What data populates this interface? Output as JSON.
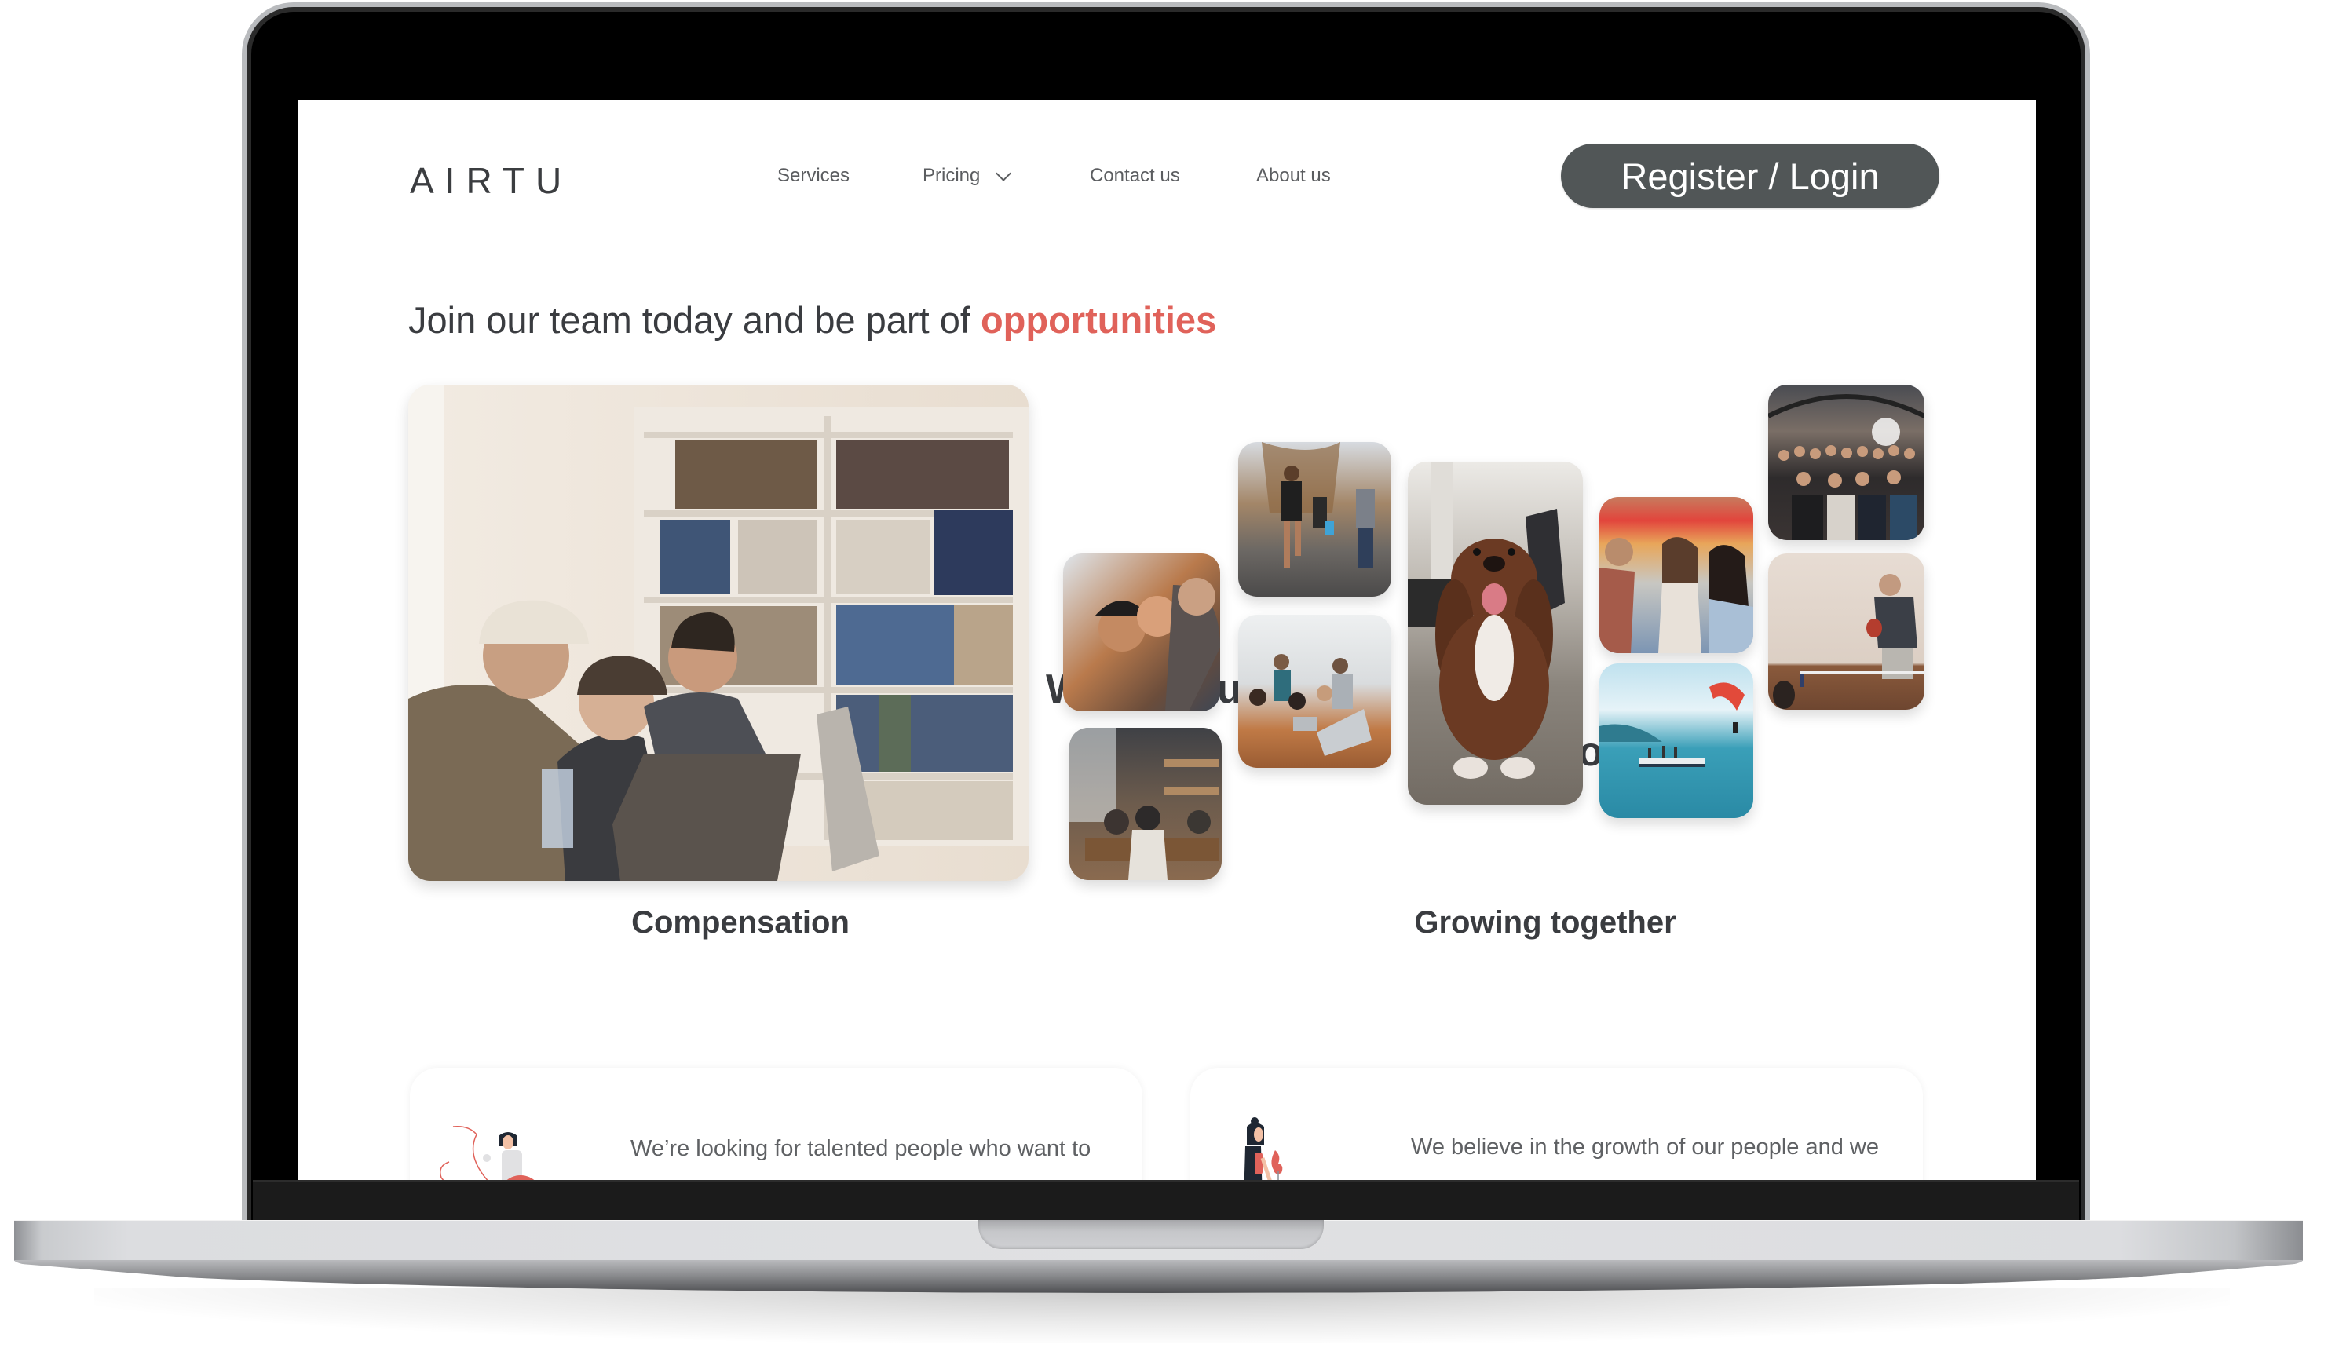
{
  "brand": {
    "logo_text": "AIRTU",
    "accent_color": "#e0625a",
    "button_color": "#515657",
    "text_color": "#3a3c40"
  },
  "nav": {
    "items": [
      {
        "label": "Services"
      },
      {
        "label": "Pricing",
        "has_dropdown": true,
        "icon": "chevron-down-icon"
      },
      {
        "label": "Contact us"
      },
      {
        "label": "About us"
      }
    ],
    "register_login_label": "Register / Login"
  },
  "hero": {
    "headline_prefix": "Join our team today and be part of ",
    "headline_accent": "opportunities"
  },
  "sections": {
    "compensation_caption": "Compensation",
    "growing_caption": "Growing together",
    "occluded_text_fragment_left": "W",
    "occluded_text_fragment_mid": "u",
    "occluded_text_fragment_right": "o"
  },
  "photos": {
    "main": "team-laughing-at-laptop-library",
    "collage": [
      "friends-hugging",
      "cafe-meeting",
      "group-running-outdoors",
      "team-meeting-laptops",
      "dog-in-office",
      "friends-laughing-flowers",
      "lake-kitesurfing",
      "company-group-photo",
      "ping-pong-player"
    ]
  },
  "cards": [
    {
      "illustration": "woman-with-globe-illustration",
      "text_line1": "We’re looking for talented people who want to"
    },
    {
      "illustration": "woman-with-plant-illustration",
      "text_line1": "We believe in the growth of our people and we"
    }
  ]
}
